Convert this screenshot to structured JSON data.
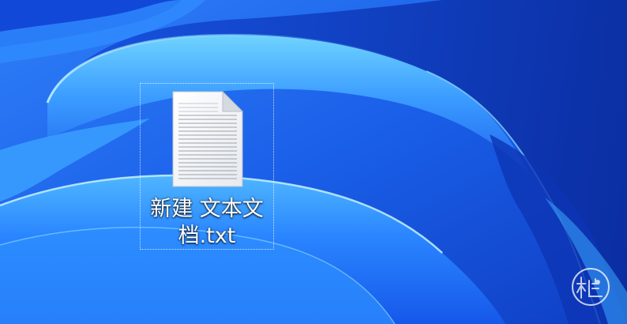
{
  "desktop": {
    "icons": [
      {
        "name": "新建 文本文档.txt",
        "icon": "text-document-icon",
        "selected": true
      }
    ]
  },
  "watermark": {
    "icon": "logo-watermark"
  },
  "colors": {
    "wallpaper_base": "#1b67f0",
    "wallpaper_highlight": "#5cc8ff",
    "wallpaper_deep": "#0b2fa8",
    "label_text": "#ffffff"
  }
}
